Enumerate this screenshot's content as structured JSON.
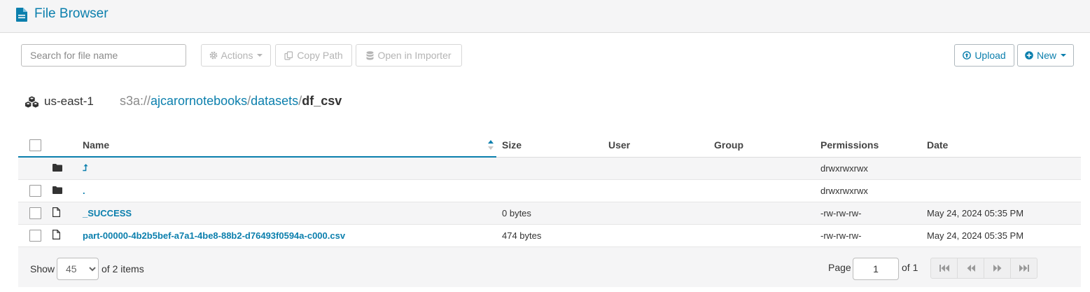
{
  "header": {
    "title": "File Browser",
    "icon": "document-icon"
  },
  "toolbar": {
    "search_placeholder": "Search for file name",
    "actions_label": "Actions",
    "copy_path_label": "Copy Path",
    "open_importer_label": "Open in Importer",
    "upload_label": "Upload",
    "new_label": "New"
  },
  "location": {
    "region": "us-east-1",
    "scheme": "s3a://",
    "segments": [
      "ajcarornotebooks",
      "datasets"
    ],
    "separator": "/",
    "current": "df_csv"
  },
  "table": {
    "columns": [
      "Name",
      "Size",
      "User",
      "Group",
      "Permissions",
      "Date"
    ],
    "sorted_by": "Name",
    "rows": [
      {
        "type": "folder",
        "name": "⮥",
        "size": "",
        "user": "",
        "group": "",
        "permissions": "drwxrwxrwx",
        "date": ""
      },
      {
        "type": "folder",
        "name": ".",
        "size": "",
        "user": "",
        "group": "",
        "permissions": "drwxrwxrwx",
        "date": ""
      },
      {
        "type": "file",
        "name": "_SUCCESS",
        "size": "0 bytes",
        "user": "",
        "group": "",
        "permissions": "-rw-rw-rw-",
        "date": "May 24, 2024 05:35 PM"
      },
      {
        "type": "file",
        "name": "part-00000-4b2b5bef-a7a1-4be8-88b2-d76493f0594a-c000.csv",
        "size": "474 bytes",
        "user": "",
        "group": "",
        "permissions": "-rw-rw-rw-",
        "date": "May 24, 2024 05:35 PM"
      }
    ]
  },
  "footer": {
    "show_label": "Show",
    "page_size": "45",
    "items_text": "of 2 items",
    "page_label": "Page",
    "page_value": "1",
    "of_pages": "of 1"
  },
  "colors": {
    "accent": "#0b7fad",
    "header_bg": "#f5f5f6"
  }
}
